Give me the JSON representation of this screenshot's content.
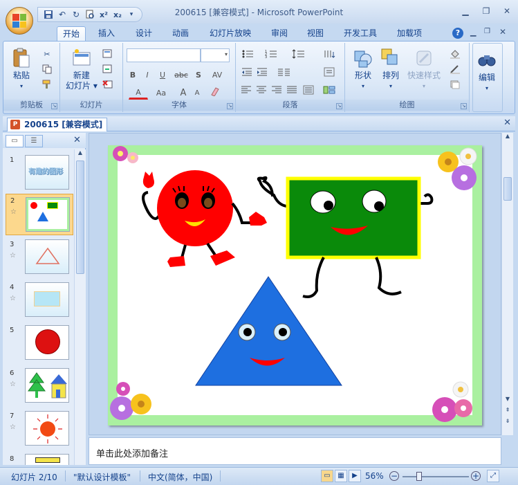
{
  "window": {
    "title": "200615 [兼容模式] - Microsoft PowerPoint"
  },
  "tabs": [
    {
      "label": "开始",
      "active": true
    },
    {
      "label": "插入"
    },
    {
      "label": "设计"
    },
    {
      "label": "动画"
    },
    {
      "label": "幻灯片放映"
    },
    {
      "label": "审阅"
    },
    {
      "label": "视图"
    },
    {
      "label": "开发工具"
    },
    {
      "label": "加载项"
    }
  ],
  "ribbon": {
    "clipboard": {
      "paste": "粘贴",
      "group": "剪贴板"
    },
    "slides": {
      "new_slide": "新建",
      "new_slide2": "幻灯片",
      "group": "幻灯片"
    },
    "font": {
      "group": "字体",
      "bold": "B",
      "italic": "I",
      "underline": "U",
      "strike": "abc",
      "shadow": "S",
      "spacing": "AV",
      "font_color": "A",
      "case": "Aa",
      "grow": "A",
      "shrink": "A"
    },
    "paragraph": {
      "group": "段落"
    },
    "drawing": {
      "shape": "形状",
      "arrange": "排列",
      "quick_styles": "快速样式",
      "group": "绘图"
    },
    "editing": {
      "label": "编辑"
    }
  },
  "document_tab": {
    "label": "200615 [兼容模式]"
  },
  "thumbnails": [
    {
      "num": "1",
      "text": "有趣的图形"
    },
    {
      "num": "2",
      "selected": true,
      "star": "☆"
    },
    {
      "num": "3",
      "star": "☆"
    },
    {
      "num": "4",
      "star": "☆"
    },
    {
      "num": "5"
    },
    {
      "num": "6",
      "star": "☆"
    },
    {
      "num": "7",
      "star": "☆"
    },
    {
      "num": "8"
    }
  ],
  "notes": {
    "placeholder": "单击此处添加备注"
  },
  "status": {
    "slide": "幻灯片 2/10",
    "theme": "\"默认设计模板\"",
    "language": "中文(简体，中国)",
    "zoom": "56%"
  },
  "colors": {
    "slide_border": "#aaf0a0",
    "circle": "#ff0000",
    "rectangle": "#0a8a0a",
    "rectangle_border": "#ffff00",
    "triangle": "#1e6fe0"
  }
}
